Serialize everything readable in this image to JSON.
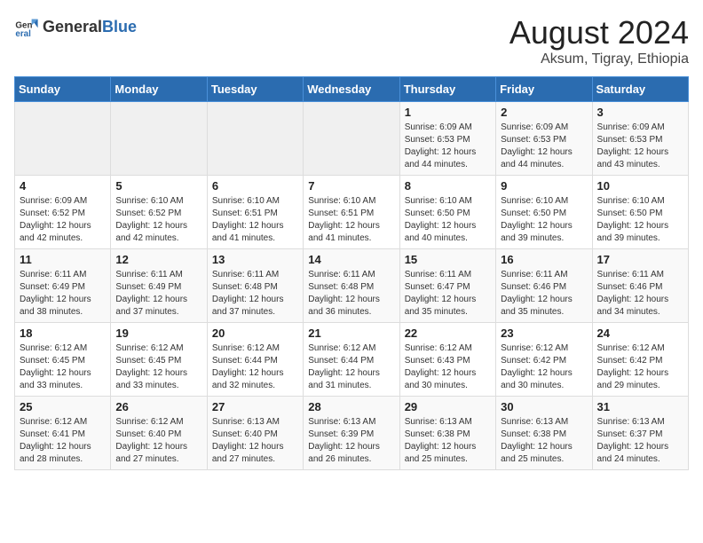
{
  "header": {
    "logo_general": "General",
    "logo_blue": "Blue",
    "title": "August 2024",
    "subtitle": "Aksum, Tigray, Ethiopia"
  },
  "calendar": {
    "days_of_week": [
      "Sunday",
      "Monday",
      "Tuesday",
      "Wednesday",
      "Thursday",
      "Friday",
      "Saturday"
    ],
    "weeks": [
      [
        {
          "day": "",
          "info": ""
        },
        {
          "day": "",
          "info": ""
        },
        {
          "day": "",
          "info": ""
        },
        {
          "day": "",
          "info": ""
        },
        {
          "day": "1",
          "info": "Sunrise: 6:09 AM\nSunset: 6:53 PM\nDaylight: 12 hours\nand 44 minutes."
        },
        {
          "day": "2",
          "info": "Sunrise: 6:09 AM\nSunset: 6:53 PM\nDaylight: 12 hours\nand 44 minutes."
        },
        {
          "day": "3",
          "info": "Sunrise: 6:09 AM\nSunset: 6:53 PM\nDaylight: 12 hours\nand 43 minutes."
        }
      ],
      [
        {
          "day": "4",
          "info": "Sunrise: 6:09 AM\nSunset: 6:52 PM\nDaylight: 12 hours\nand 42 minutes."
        },
        {
          "day": "5",
          "info": "Sunrise: 6:10 AM\nSunset: 6:52 PM\nDaylight: 12 hours\nand 42 minutes."
        },
        {
          "day": "6",
          "info": "Sunrise: 6:10 AM\nSunset: 6:51 PM\nDaylight: 12 hours\nand 41 minutes."
        },
        {
          "day": "7",
          "info": "Sunrise: 6:10 AM\nSunset: 6:51 PM\nDaylight: 12 hours\nand 41 minutes."
        },
        {
          "day": "8",
          "info": "Sunrise: 6:10 AM\nSunset: 6:50 PM\nDaylight: 12 hours\nand 40 minutes."
        },
        {
          "day": "9",
          "info": "Sunrise: 6:10 AM\nSunset: 6:50 PM\nDaylight: 12 hours\nand 39 minutes."
        },
        {
          "day": "10",
          "info": "Sunrise: 6:10 AM\nSunset: 6:50 PM\nDaylight: 12 hours\nand 39 minutes."
        }
      ],
      [
        {
          "day": "11",
          "info": "Sunrise: 6:11 AM\nSunset: 6:49 PM\nDaylight: 12 hours\nand 38 minutes."
        },
        {
          "day": "12",
          "info": "Sunrise: 6:11 AM\nSunset: 6:49 PM\nDaylight: 12 hours\nand 37 minutes."
        },
        {
          "day": "13",
          "info": "Sunrise: 6:11 AM\nSunset: 6:48 PM\nDaylight: 12 hours\nand 37 minutes."
        },
        {
          "day": "14",
          "info": "Sunrise: 6:11 AM\nSunset: 6:48 PM\nDaylight: 12 hours\nand 36 minutes."
        },
        {
          "day": "15",
          "info": "Sunrise: 6:11 AM\nSunset: 6:47 PM\nDaylight: 12 hours\nand 35 minutes."
        },
        {
          "day": "16",
          "info": "Sunrise: 6:11 AM\nSunset: 6:46 PM\nDaylight: 12 hours\nand 35 minutes."
        },
        {
          "day": "17",
          "info": "Sunrise: 6:11 AM\nSunset: 6:46 PM\nDaylight: 12 hours\nand 34 minutes."
        }
      ],
      [
        {
          "day": "18",
          "info": "Sunrise: 6:12 AM\nSunset: 6:45 PM\nDaylight: 12 hours\nand 33 minutes."
        },
        {
          "day": "19",
          "info": "Sunrise: 6:12 AM\nSunset: 6:45 PM\nDaylight: 12 hours\nand 33 minutes."
        },
        {
          "day": "20",
          "info": "Sunrise: 6:12 AM\nSunset: 6:44 PM\nDaylight: 12 hours\nand 32 minutes."
        },
        {
          "day": "21",
          "info": "Sunrise: 6:12 AM\nSunset: 6:44 PM\nDaylight: 12 hours\nand 31 minutes."
        },
        {
          "day": "22",
          "info": "Sunrise: 6:12 AM\nSunset: 6:43 PM\nDaylight: 12 hours\nand 30 minutes."
        },
        {
          "day": "23",
          "info": "Sunrise: 6:12 AM\nSunset: 6:42 PM\nDaylight: 12 hours\nand 30 minutes."
        },
        {
          "day": "24",
          "info": "Sunrise: 6:12 AM\nSunset: 6:42 PM\nDaylight: 12 hours\nand 29 minutes."
        }
      ],
      [
        {
          "day": "25",
          "info": "Sunrise: 6:12 AM\nSunset: 6:41 PM\nDaylight: 12 hours\nand 28 minutes."
        },
        {
          "day": "26",
          "info": "Sunrise: 6:12 AM\nSunset: 6:40 PM\nDaylight: 12 hours\nand 27 minutes."
        },
        {
          "day": "27",
          "info": "Sunrise: 6:13 AM\nSunset: 6:40 PM\nDaylight: 12 hours\nand 27 minutes."
        },
        {
          "day": "28",
          "info": "Sunrise: 6:13 AM\nSunset: 6:39 PM\nDaylight: 12 hours\nand 26 minutes."
        },
        {
          "day": "29",
          "info": "Sunrise: 6:13 AM\nSunset: 6:38 PM\nDaylight: 12 hours\nand 25 minutes."
        },
        {
          "day": "30",
          "info": "Sunrise: 6:13 AM\nSunset: 6:38 PM\nDaylight: 12 hours\nand 25 minutes."
        },
        {
          "day": "31",
          "info": "Sunrise: 6:13 AM\nSunset: 6:37 PM\nDaylight: 12 hours\nand 24 minutes."
        }
      ]
    ]
  }
}
